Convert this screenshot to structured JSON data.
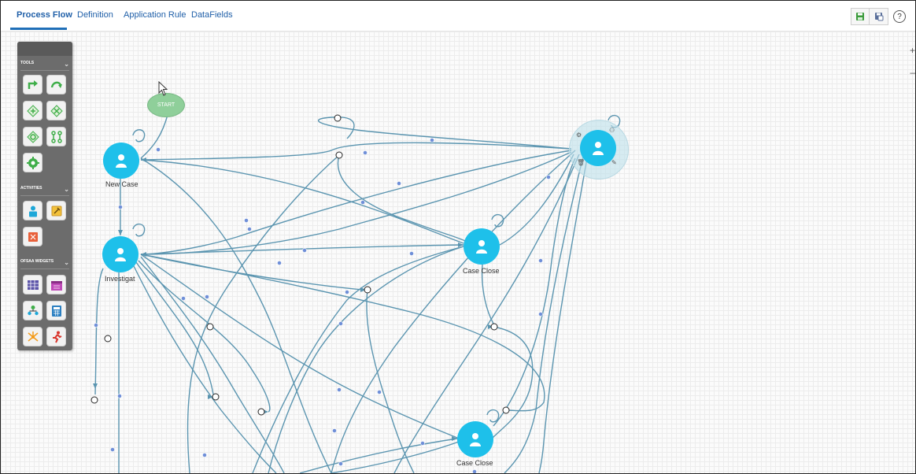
{
  "tabs": [
    {
      "label": "Process Flow",
      "active": true
    },
    {
      "label": "Definition",
      "active": false
    },
    {
      "label": "Application Rule",
      "active": false
    },
    {
      "label": "DataFields",
      "active": false
    }
  ],
  "toolbar": {
    "save_icon": "save-icon",
    "save_as_icon": "save-as-icon",
    "help_label": "?"
  },
  "palette": {
    "sections": [
      {
        "label": "TOOLS"
      },
      {
        "label": "ACTIVITIES"
      },
      {
        "label": "OFSAA WIDGETS"
      }
    ],
    "tools": [
      "transition-icon",
      "loop-transition-icon",
      "decision-icon",
      "parallel-gateway-icon",
      "join-icon",
      "split-icon",
      "subprocess-gear-icon"
    ],
    "activities": [
      "human-task-icon",
      "service-task-icon",
      "script-task-icon"
    ],
    "widgets": [
      "calendar-grid-icon",
      "calendar-icon",
      "org-chart-icon",
      "calculator-icon",
      "network-icon",
      "runner-icon"
    ]
  },
  "nodes": {
    "start": {
      "label": "START"
    },
    "new_case": {
      "label": "New Case"
    },
    "investigate": {
      "label": "Investigat"
    },
    "case_close_1": {
      "label": "Case Close"
    },
    "case_close_2": {
      "label": "Case Close"
    },
    "selected": {
      "label": ""
    }
  },
  "colors": {
    "accent": "#1f6fb8",
    "node": "#1ec0ea",
    "start_node": "#8fcf9a",
    "edge": "#5b95b0",
    "palette_bg": "#6c6c6c"
  }
}
